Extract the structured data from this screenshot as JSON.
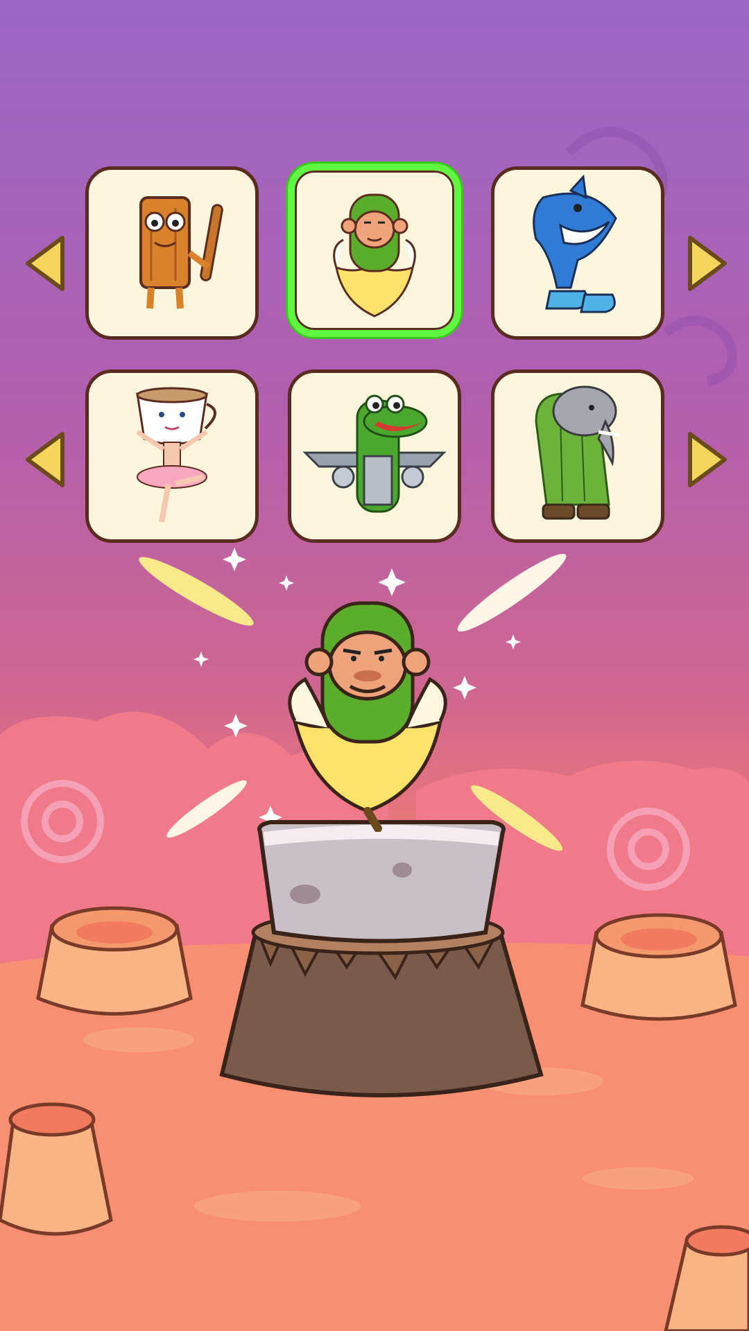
{
  "selector": {
    "rows": [
      {
        "row": 1,
        "items": [
          {
            "character": "wooden-log-with-bat",
            "selected": false
          },
          {
            "character": "monkey-in-banana",
            "selected": true
          },
          {
            "character": "shark-in-sneakers",
            "selected": false
          }
        ]
      },
      {
        "row": 2,
        "items": [
          {
            "character": "ballerina-cappuccino-cup",
            "selected": false
          },
          {
            "character": "crocodile-airplane",
            "selected": false
          },
          {
            "character": "elephant-cactus-sandals",
            "selected": false
          }
        ]
      }
    ],
    "arrows": [
      "left-arrow-icon",
      "right-arrow-icon"
    ]
  },
  "display": {
    "character": "monkey-in-banana",
    "pedestal": "stone-on-tree-stump"
  },
  "colors": {
    "selected_border": "#5ff73f",
    "card_background": "#fbf6dc",
    "card_border": "#5a2b1f",
    "arrow_fill": "#f6d55c",
    "sky_top": "#9a67c4",
    "ground": "#f98f72"
  }
}
